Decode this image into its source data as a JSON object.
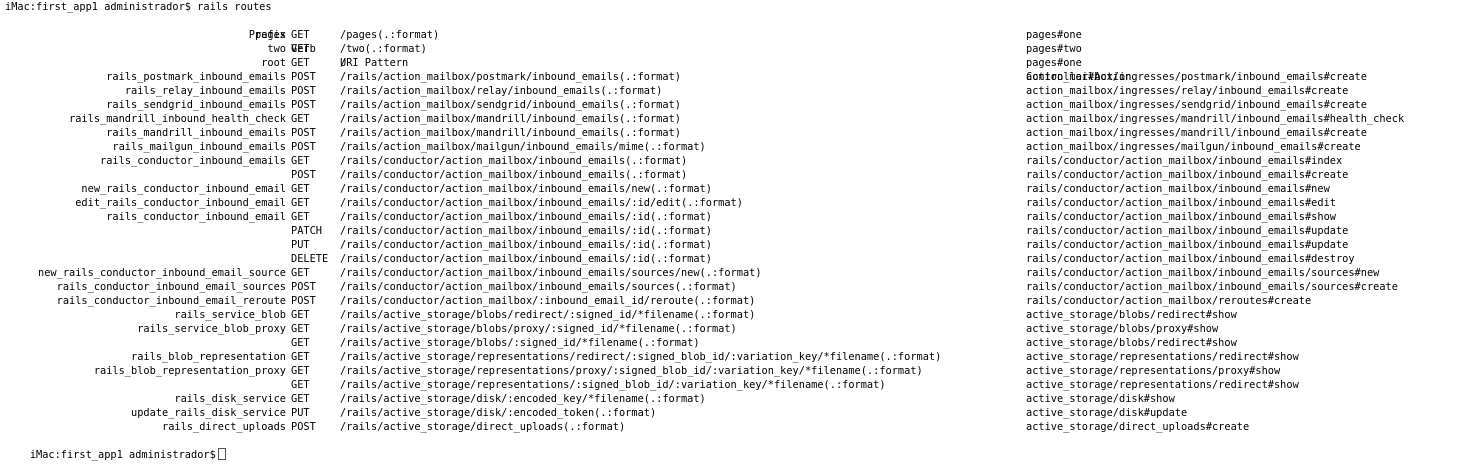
{
  "terminal": {
    "command_line": "iMac:first_app1 administrador$ rails routes",
    "prompt": "iMac:first_app1 administrador$",
    "header": {
      "prefix": "Prefix",
      "verb": "Verb",
      "uri": "URI Pattern",
      "action": "Controller#Action"
    },
    "routes": [
      {
        "prefix": "pages",
        "verb": "GET",
        "uri": "/pages(.:format)",
        "action": "pages#one"
      },
      {
        "prefix": "two",
        "verb": "GET",
        "uri": "/two(.:format)",
        "action": "pages#two"
      },
      {
        "prefix": "root",
        "verb": "GET",
        "uri": "/",
        "action": "pages#one"
      },
      {
        "prefix": "rails_postmark_inbound_emails",
        "verb": "POST",
        "uri": "/rails/action_mailbox/postmark/inbound_emails(.:format)",
        "action": "action_mailbox/ingresses/postmark/inbound_emails#create"
      },
      {
        "prefix": "rails_relay_inbound_emails",
        "verb": "POST",
        "uri": "/rails/action_mailbox/relay/inbound_emails(.:format)",
        "action": "action_mailbox/ingresses/relay/inbound_emails#create"
      },
      {
        "prefix": "rails_sendgrid_inbound_emails",
        "verb": "POST",
        "uri": "/rails/action_mailbox/sendgrid/inbound_emails(.:format)",
        "action": "action_mailbox/ingresses/sendgrid/inbound_emails#create"
      },
      {
        "prefix": "rails_mandrill_inbound_health_check",
        "verb": "GET",
        "uri": "/rails/action_mailbox/mandrill/inbound_emails(.:format)",
        "action": "action_mailbox/ingresses/mandrill/inbound_emails#health_check"
      },
      {
        "prefix": "rails_mandrill_inbound_emails",
        "verb": "POST",
        "uri": "/rails/action_mailbox/mandrill/inbound_emails(.:format)",
        "action": "action_mailbox/ingresses/mandrill/inbound_emails#create"
      },
      {
        "prefix": "rails_mailgun_inbound_emails",
        "verb": "POST",
        "uri": "/rails/action_mailbox/mailgun/inbound_emails/mime(.:format)",
        "action": "action_mailbox/ingresses/mailgun/inbound_emails#create"
      },
      {
        "prefix": "rails_conductor_inbound_emails",
        "verb": "GET",
        "uri": "/rails/conductor/action_mailbox/inbound_emails(.:format)",
        "action": "rails/conductor/action_mailbox/inbound_emails#index"
      },
      {
        "prefix": "",
        "verb": "POST",
        "uri": "/rails/conductor/action_mailbox/inbound_emails(.:format)",
        "action": "rails/conductor/action_mailbox/inbound_emails#create"
      },
      {
        "prefix": "new_rails_conductor_inbound_email",
        "verb": "GET",
        "uri": "/rails/conductor/action_mailbox/inbound_emails/new(.:format)",
        "action": "rails/conductor/action_mailbox/inbound_emails#new"
      },
      {
        "prefix": "edit_rails_conductor_inbound_email",
        "verb": "GET",
        "uri": "/rails/conductor/action_mailbox/inbound_emails/:id/edit(.:format)",
        "action": "rails/conductor/action_mailbox/inbound_emails#edit"
      },
      {
        "prefix": "rails_conductor_inbound_email",
        "verb": "GET",
        "uri": "/rails/conductor/action_mailbox/inbound_emails/:id(.:format)",
        "action": "rails/conductor/action_mailbox/inbound_emails#show"
      },
      {
        "prefix": "",
        "verb": "PATCH",
        "uri": "/rails/conductor/action_mailbox/inbound_emails/:id(.:format)",
        "action": "rails/conductor/action_mailbox/inbound_emails#update"
      },
      {
        "prefix": "",
        "verb": "PUT",
        "uri": "/rails/conductor/action_mailbox/inbound_emails/:id(.:format)",
        "action": "rails/conductor/action_mailbox/inbound_emails#update"
      },
      {
        "prefix": "",
        "verb": "DELETE",
        "uri": "/rails/conductor/action_mailbox/inbound_emails/:id(.:format)",
        "action": "rails/conductor/action_mailbox/inbound_emails#destroy"
      },
      {
        "prefix": "new_rails_conductor_inbound_email_source",
        "verb": "GET",
        "uri": "/rails/conductor/action_mailbox/inbound_emails/sources/new(.:format)",
        "action": "rails/conductor/action_mailbox/inbound_emails/sources#new"
      },
      {
        "prefix": "rails_conductor_inbound_email_sources",
        "verb": "POST",
        "uri": "/rails/conductor/action_mailbox/inbound_emails/sources(.:format)",
        "action": "rails/conductor/action_mailbox/inbound_emails/sources#create"
      },
      {
        "prefix": "rails_conductor_inbound_email_reroute",
        "verb": "POST",
        "uri": "/rails/conductor/action_mailbox/:inbound_email_id/reroute(.:format)",
        "action": "rails/conductor/action_mailbox/reroutes#create"
      },
      {
        "prefix": "rails_service_blob",
        "verb": "GET",
        "uri": "/rails/active_storage/blobs/redirect/:signed_id/*filename(.:format)",
        "action": "active_storage/blobs/redirect#show"
      },
      {
        "prefix": "rails_service_blob_proxy",
        "verb": "GET",
        "uri": "/rails/active_storage/blobs/proxy/:signed_id/*filename(.:format)",
        "action": "active_storage/blobs/proxy#show"
      },
      {
        "prefix": "",
        "verb": "GET",
        "uri": "/rails/active_storage/blobs/:signed_id/*filename(.:format)",
        "action": "active_storage/blobs/redirect#show"
      },
      {
        "prefix": "rails_blob_representation",
        "verb": "GET",
        "uri": "/rails/active_storage/representations/redirect/:signed_blob_id/:variation_key/*filename(.:format)",
        "action": "active_storage/representations/redirect#show"
      },
      {
        "prefix": "rails_blob_representation_proxy",
        "verb": "GET",
        "uri": "/rails/active_storage/representations/proxy/:signed_blob_id/:variation_key/*filename(.:format)",
        "action": "active_storage/representations/proxy#show"
      },
      {
        "prefix": "",
        "verb": "GET",
        "uri": "/rails/active_storage/representations/:signed_blob_id/:variation_key/*filename(.:format)",
        "action": "active_storage/representations/redirect#show"
      },
      {
        "prefix": "rails_disk_service",
        "verb": "GET",
        "uri": "/rails/active_storage/disk/:encoded_key/*filename(.:format)",
        "action": "active_storage/disk#show"
      },
      {
        "prefix": "update_rails_disk_service",
        "verb": "PUT",
        "uri": "/rails/active_storage/disk/:encoded_token(.:format)",
        "action": "active_storage/disk#update"
      },
      {
        "prefix": "rails_direct_uploads",
        "verb": "POST",
        "uri": "/rails/active_storage/direct_uploads(.:format)",
        "action": "active_storage/direct_uploads#create"
      }
    ]
  }
}
